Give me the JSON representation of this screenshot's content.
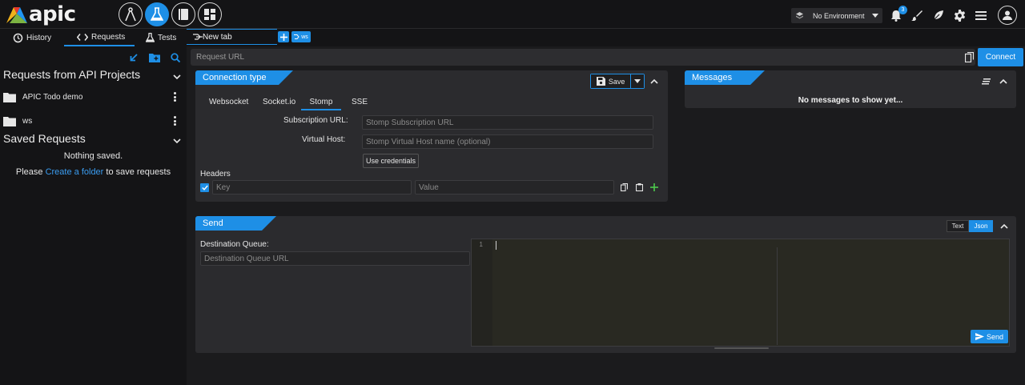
{
  "app": {
    "logo_text": "apic"
  },
  "topbar": {
    "environment": "No Environment",
    "notification_count": "3"
  },
  "nav": {
    "tabs": [
      {
        "label": "History"
      },
      {
        "label": "Requests"
      },
      {
        "label": "Tests"
      }
    ],
    "open_tab": "New tab",
    "ws_tag": "ws"
  },
  "sidebar": {
    "requests_title": "Requests from API Projects",
    "projects": [
      {
        "label": "APIC Todo demo"
      },
      {
        "label": "ws"
      }
    ],
    "saved_title": "Saved Requests",
    "nothing_saved": "Nothing saved.",
    "please": "Please",
    "create_link": "Create a folder",
    "save_suffix": "to save requests"
  },
  "request": {
    "url_placeholder": "Request URL",
    "connect_label": "Connect"
  },
  "connection": {
    "title": "Connection type",
    "save_label": "Save",
    "tabs": [
      "Websocket",
      "Socket.io",
      "Stomp",
      "SSE"
    ],
    "active_tab": "Stomp",
    "subscription_label": "Subscription URL:",
    "subscription_placeholder": "Stomp Subscription URL",
    "vhost_label": "Virtual Host:",
    "vhost_placeholder": "Stomp Virtual Host name (optional)",
    "credentials_label": "Use credentials",
    "headers_label": "Headers",
    "key_placeholder": "Key",
    "value_placeholder": "Value"
  },
  "messages": {
    "title": "Messages",
    "empty_text": "No messages to show yet..."
  },
  "send": {
    "title": "Send",
    "text_label": "Text",
    "json_label": "Json",
    "dest_label": "Destination Queue:",
    "dest_placeholder": "Destination Queue URL",
    "line_number": "1",
    "send_label": "Send"
  },
  "colors": {
    "accent": "#1e8fe6",
    "background": "#1b1b1d",
    "panel": "#2b2b2e",
    "add_green": "#4cc94c"
  }
}
